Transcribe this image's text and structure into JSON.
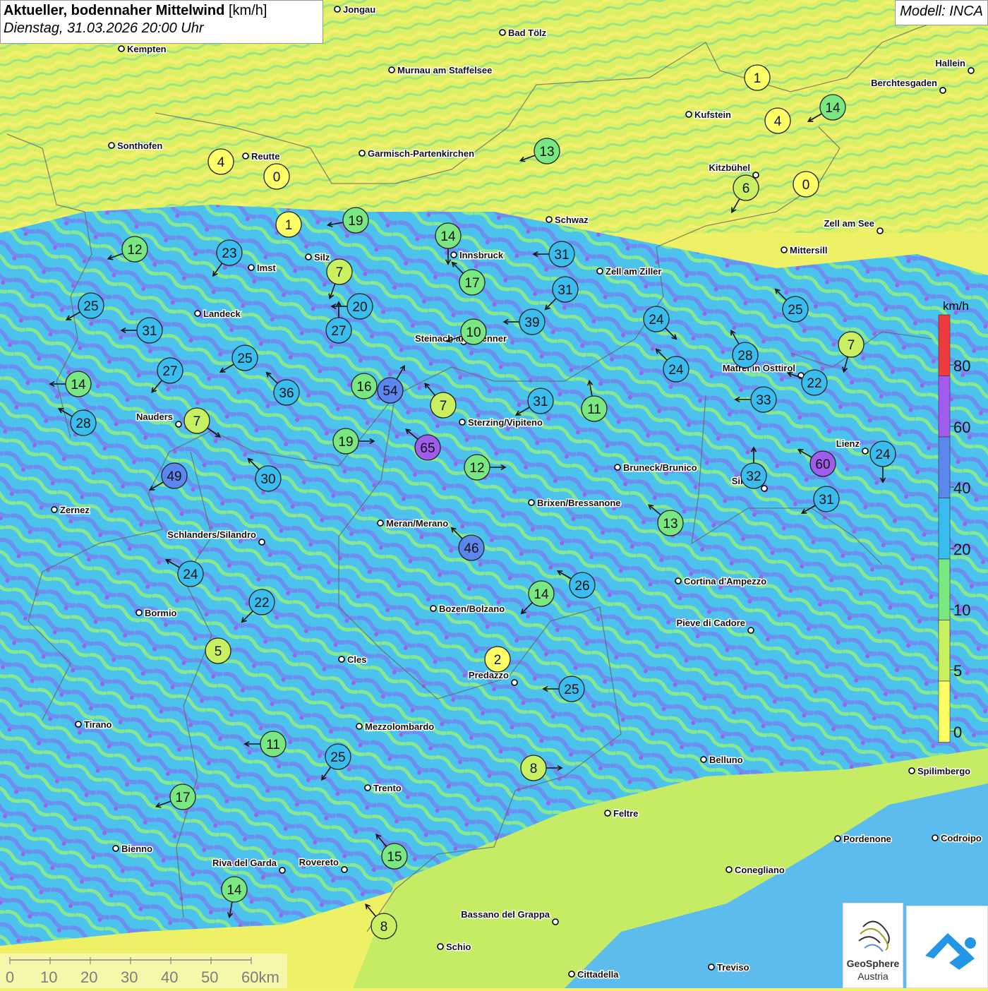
{
  "title": {
    "main": "Aktueller, bodennaher Mittelwind",
    "unit": "[km/h]",
    "datetime": "Dienstag, 31.03.2026 20:00 Uhr"
  },
  "model_label": "Modell: INCA",
  "legend": {
    "unit": "km/h",
    "ticks": [
      "0",
      "5",
      "10",
      "20",
      "40",
      "60",
      "80"
    ],
    "colors": [
      "#ffff66",
      "#c8f060",
      "#7ae882",
      "#39bcee",
      "#5b86ee",
      "#a05cee",
      "#ee3b40"
    ]
  },
  "scale_bar": {
    "labels": [
      "0",
      "10",
      "20",
      "30",
      "40",
      "50",
      "60km"
    ]
  },
  "logo": {
    "line1": "GeoSphere",
    "line2": "Austria"
  },
  "cities": [
    {
      "name": "Bad Tölz"
    },
    {
      "name": "Kempten"
    },
    {
      "name": "Murnau am Staffelsee"
    },
    {
      "name": "Hallein"
    },
    {
      "name": "Berchtesgaden"
    },
    {
      "name": "Kufstein"
    },
    {
      "name": "Sonthofen"
    },
    {
      "name": "Reutte"
    },
    {
      "name": "Garmisch-Partenkirchen"
    },
    {
      "name": "Kitzbühel"
    },
    {
      "name": "Schwaz"
    },
    {
      "name": "Zell am See"
    },
    {
      "name": "Innsbruck"
    },
    {
      "name": "Silz"
    },
    {
      "name": "Imst"
    },
    {
      "name": "Mittersill"
    },
    {
      "name": "Zell am Ziller"
    },
    {
      "name": "Landeck"
    },
    {
      "name": "Steinach am Brenner"
    },
    {
      "name": "Matrei in Osttirol"
    },
    {
      "name": "Nauders"
    },
    {
      "name": "Sterzing/Vipiteno"
    },
    {
      "name": "Lienz"
    },
    {
      "name": "Bruneck/Brunico"
    },
    {
      "name": "Sillian"
    },
    {
      "name": "Zernez"
    },
    {
      "name": "Brixen/Bressanone"
    },
    {
      "name": "Meran/Merano"
    },
    {
      "name": "Schlanders/Silandro"
    },
    {
      "name": "Cortina d'Ampezzo"
    },
    {
      "name": "Bormio"
    },
    {
      "name": "Bozen/Bolzano"
    },
    {
      "name": "Pieve di Cadore"
    },
    {
      "name": "Cles"
    },
    {
      "name": "Predazzo"
    },
    {
      "name": "Tirano"
    },
    {
      "name": "Mezzolombardo"
    },
    {
      "name": "Belluno"
    },
    {
      "name": "Spilimbergo"
    },
    {
      "name": "Trento"
    },
    {
      "name": "Feltre"
    },
    {
      "name": "Pordenone"
    },
    {
      "name": "Codroipo"
    },
    {
      "name": "Bienno"
    },
    {
      "name": "Riva del Garda"
    },
    {
      "name": "Rovereto"
    },
    {
      "name": "Conegliano"
    },
    {
      "name": "Bassano del Grappa"
    },
    {
      "name": "Schio"
    },
    {
      "name": "Cittadella"
    },
    {
      "name": "Treviso"
    },
    {
      "name": "Jongau"
    }
  ],
  "stations": [
    {
      "value": 1,
      "dir_deg": null
    },
    {
      "value": 4,
      "dir_deg": null
    },
    {
      "value": 14,
      "dir_deg": 240
    },
    {
      "value": 4,
      "dir_deg": null
    },
    {
      "value": 0,
      "dir_deg": null
    },
    {
      "value": 13,
      "dir_deg": 250
    },
    {
      "value": 6,
      "dir_deg": 210
    },
    {
      "value": 0,
      "dir_deg": null
    },
    {
      "value": 1,
      "dir_deg": null
    },
    {
      "value": 19,
      "dir_deg": 260
    },
    {
      "value": 14,
      "dir_deg": 180
    },
    {
      "value": 12,
      "dir_deg": 250
    },
    {
      "value": 23,
      "dir_deg": 215
    },
    {
      "value": 31,
      "dir_deg": 270
    },
    {
      "value": 7,
      "dir_deg": 200
    },
    {
      "value": 17,
      "dir_deg": 315
    },
    {
      "value": 31,
      "dir_deg": 225
    },
    {
      "value": 25,
      "dir_deg": 240
    },
    {
      "value": 20,
      "dir_deg": 270
    },
    {
      "value": 27,
      "dir_deg": 0
    },
    {
      "value": 39,
      "dir_deg": 270
    },
    {
      "value": 10,
      "dir_deg": 250
    },
    {
      "value": 24,
      "dir_deg": 135
    },
    {
      "value": 25,
      "dir_deg": 315
    },
    {
      "value": 31,
      "dir_deg": 270
    },
    {
      "value": 7,
      "dir_deg": 195
    },
    {
      "value": 25,
      "dir_deg": 240
    },
    {
      "value": 28,
      "dir_deg": 330
    },
    {
      "value": 24,
      "dir_deg": 315
    },
    {
      "value": 27,
      "dir_deg": 220
    },
    {
      "value": 14,
      "dir_deg": 270
    },
    {
      "value": 16,
      "dir_deg": null
    },
    {
      "value": 54,
      "dir_deg": 30
    },
    {
      "value": 36,
      "dir_deg": 315
    },
    {
      "value": 7,
      "dir_deg": 320
    },
    {
      "value": 31,
      "dir_deg": 240
    },
    {
      "value": 11,
      "dir_deg": 350
    },
    {
      "value": 22,
      "dir_deg": 290
    },
    {
      "value": 33,
      "dir_deg": 270
    },
    {
      "value": 28,
      "dir_deg": 300
    },
    {
      "value": 7,
      "dir_deg": 125
    },
    {
      "value": 19,
      "dir_deg": 90
    },
    {
      "value": 65,
      "dir_deg": 310
    },
    {
      "value": 49,
      "dir_deg": 240
    },
    {
      "value": 30,
      "dir_deg": 315
    },
    {
      "value": 12,
      "dir_deg": 90
    },
    {
      "value": 32,
      "dir_deg": 0
    },
    {
      "value": 60,
      "dir_deg": 300
    },
    {
      "value": 24,
      "dir_deg": 180
    },
    {
      "value": 31,
      "dir_deg": 240
    },
    {
      "value": 13,
      "dir_deg": 310
    },
    {
      "value": 46,
      "dir_deg": 315
    },
    {
      "value": 24,
      "dir_deg": 300
    },
    {
      "value": 26,
      "dir_deg": 300
    },
    {
      "value": 14,
      "dir_deg": 225
    },
    {
      "value": 22,
      "dir_deg": 225
    },
    {
      "value": 5,
      "dir_deg": null
    },
    {
      "value": 2,
      "dir_deg": null
    },
    {
      "value": 25,
      "dir_deg": 270
    },
    {
      "value": 11,
      "dir_deg": 270
    },
    {
      "value": 25,
      "dir_deg": 215
    },
    {
      "value": 8,
      "dir_deg": 90
    },
    {
      "value": 17,
      "dir_deg": 250
    },
    {
      "value": 15,
      "dir_deg": 320
    },
    {
      "value": 14,
      "dir_deg": 190
    },
    {
      "value": 8,
      "dir_deg": 320
    }
  ]
}
